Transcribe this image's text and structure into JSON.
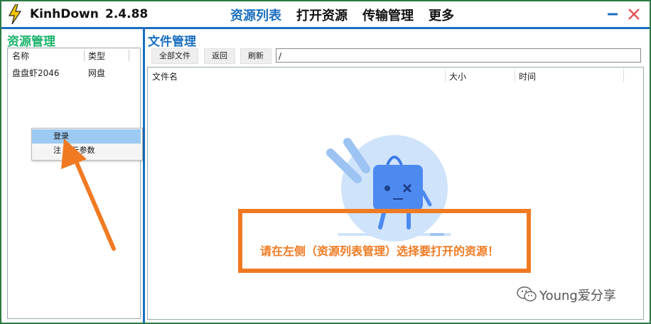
{
  "app": {
    "name": "KinhDown",
    "version": "2.4.88"
  },
  "menu": [
    {
      "label": "资源列表",
      "active": true
    },
    {
      "label": "打开资源",
      "active": false
    },
    {
      "label": "传输管理",
      "active": false
    },
    {
      "label": "更多",
      "active": false
    }
  ],
  "window": {
    "minimize_icon": "minimize-icon",
    "close_icon": "close-icon"
  },
  "left": {
    "title": "资源管理",
    "columns": [
      "名称",
      "类型"
    ],
    "rows": [
      {
        "name": "盘盘虾2046",
        "type": "网盘"
      }
    ]
  },
  "context_menu": {
    "items": [
      "登录",
      "注     寿云参数"
    ]
  },
  "right": {
    "title": "文件管理",
    "toolbar": {
      "all_files": "全部文件",
      "back": "返回",
      "refresh": "刷新"
    },
    "path": "/",
    "columns": [
      "文件名",
      "大小",
      "时间"
    ]
  },
  "empty_message": "请在左侧（资源列表管理）选择要打开的资源！",
  "watermark": "Young爱分享",
  "colors": {
    "accent_blue": "#1a6fc0",
    "accent_green": "#1ab36b",
    "callout_orange": "#f07a22",
    "context_highlight": "#9ccaf3"
  }
}
